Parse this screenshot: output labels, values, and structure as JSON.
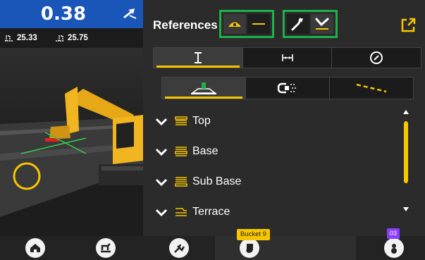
{
  "readout": {
    "value": "0.38",
    "left_elev": "25.33",
    "right_elev": "25.75"
  },
  "references": {
    "title": "References",
    "tabs": [
      {
        "name": "vertical",
        "active": true
      },
      {
        "name": "horizontal",
        "active": false
      },
      {
        "name": "compass",
        "active": false
      }
    ],
    "subtabs": [
      {
        "name": "surface",
        "active": true
      },
      {
        "name": "alignment",
        "active": false
      },
      {
        "name": "line",
        "active": false
      }
    ],
    "layers": [
      "Top",
      "Base",
      "Sub Base",
      "Terrace"
    ]
  },
  "bottom": {
    "bucket_label": "Bucket 9",
    "badge": "03"
  },
  "colors": {
    "accent": "#f7c600",
    "highlight": "#1db248",
    "readout_bg": "#1a55b8"
  }
}
